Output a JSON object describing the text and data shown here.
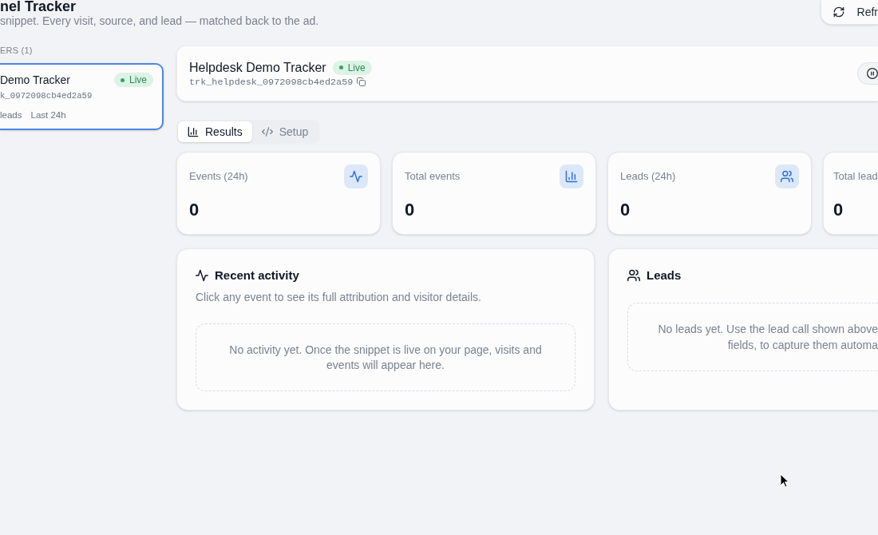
{
  "header": {
    "title": "nel Tracker",
    "subtitle": "snippet. Every visit, source, and lead — matched back to the ad.",
    "refresh_button": "Refr"
  },
  "sidebar": {
    "heading": "ERS (1)",
    "trackers": [
      {
        "name": "Demo Tracker",
        "status": "Live",
        "live": true,
        "tracker_id": "k_0972098cb4ed2a59",
        "stats": [
          "leads",
          "Last 24h"
        ],
        "selected": true
      }
    ]
  },
  "tracker": {
    "name": "Helpdesk Demo Tracker",
    "status": "Live",
    "live": true,
    "tracker_id": "trk_helpdesk_0972098cb4ed2a59"
  },
  "tabs": [
    {
      "label": "Results",
      "kind": "chart",
      "selected": true
    },
    {
      "label": "Setup",
      "kind": "code",
      "selected": false
    }
  ],
  "stats": [
    {
      "label": "Events (24h)",
      "value": "0",
      "kind": "activity"
    },
    {
      "label": "Total events",
      "value": "0",
      "kind": "chart"
    },
    {
      "label": "Leads (24h)",
      "value": "0",
      "kind": "people"
    },
    {
      "label": "Total lead",
      "value": "0",
      "kind": "plain"
    }
  ],
  "panels": [
    {
      "title": "Recent activity",
      "kind": "activity",
      "description": "Click any event to see its full attribution and visitor details.",
      "empty_message": "No activity yet. Once the snippet is live on your page, visits and events will appear here."
    },
    {
      "title": "Leads",
      "kind": "people",
      "empty_message": "No leads yet. Use the lead call shown above\nfields, to capture them automa"
    }
  ]
}
